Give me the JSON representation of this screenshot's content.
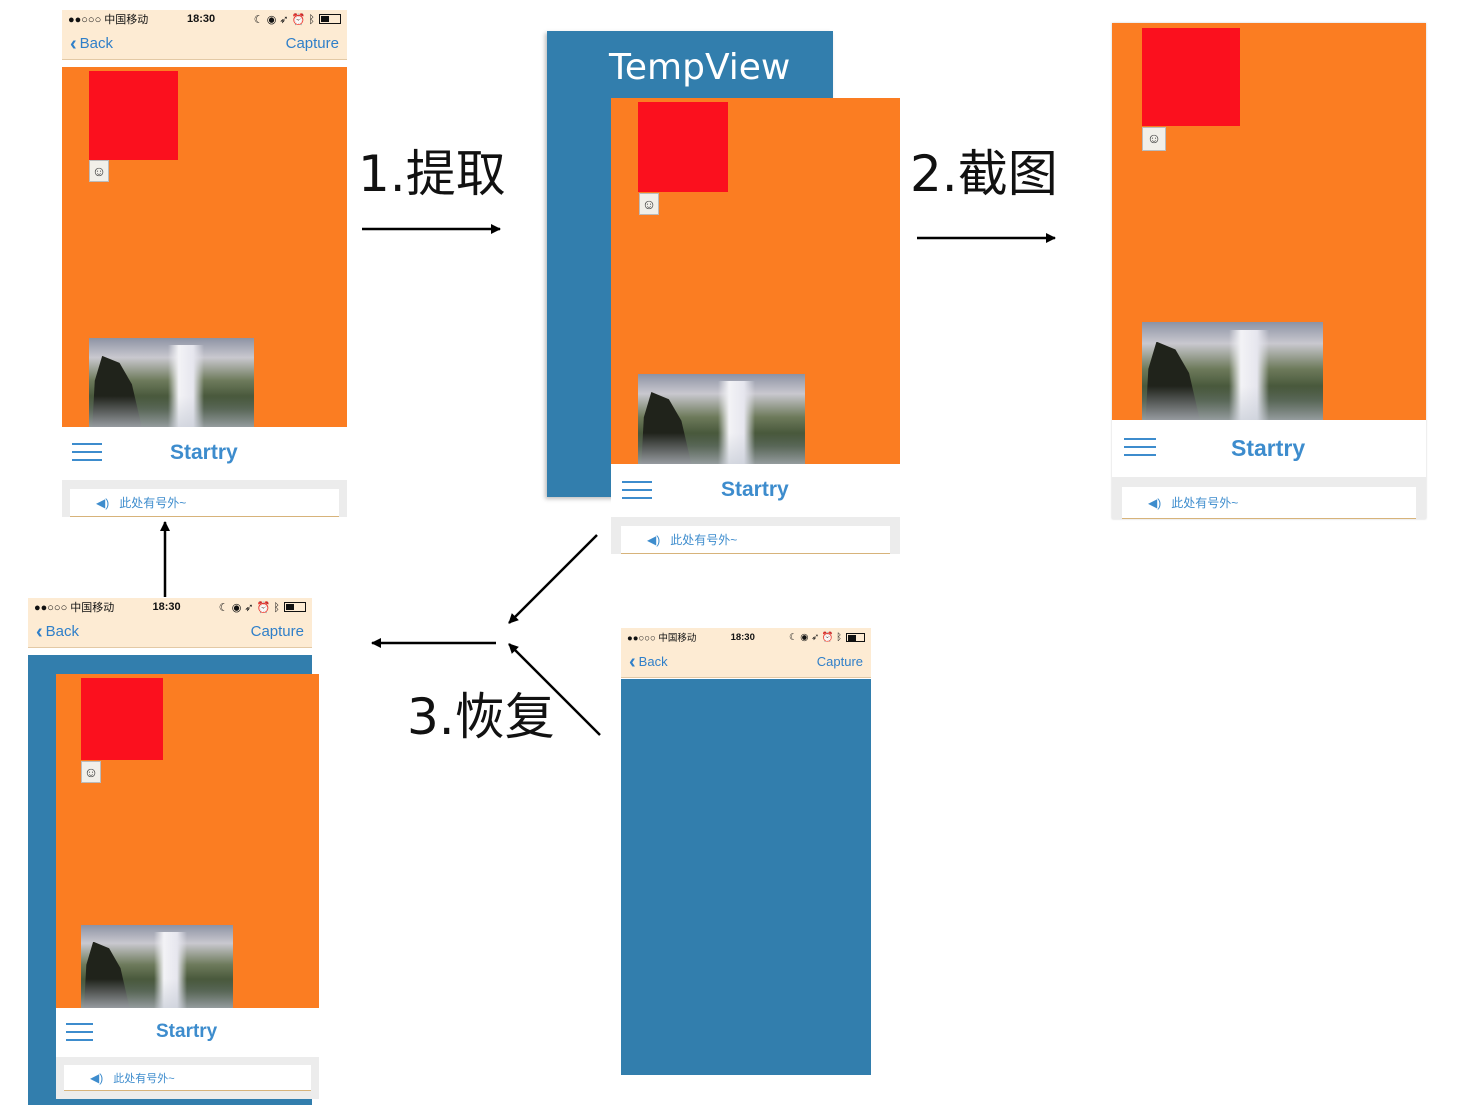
{
  "phone": {
    "carrier": "●●○○○ 中国移动",
    "wifi_icon": "wifi-icon",
    "time": "18:30",
    "status_right": "☾ ◉ ➶ ⏰ ᛒ",
    "back_label": "Back",
    "capture_label": "Capture",
    "brand": "Startry",
    "ticker_text": "此处有号外~"
  },
  "tempview_label": "TempView",
  "steps": {
    "extract": "1.提取",
    "screenshot": "2.截图",
    "restore": "3.恢复"
  },
  "colors": {
    "orange": "#fb7d22",
    "red": "#fb101e",
    "blue": "#327ead",
    "nav_bg": "#fdebd3",
    "accent": "#3d8ccd"
  }
}
